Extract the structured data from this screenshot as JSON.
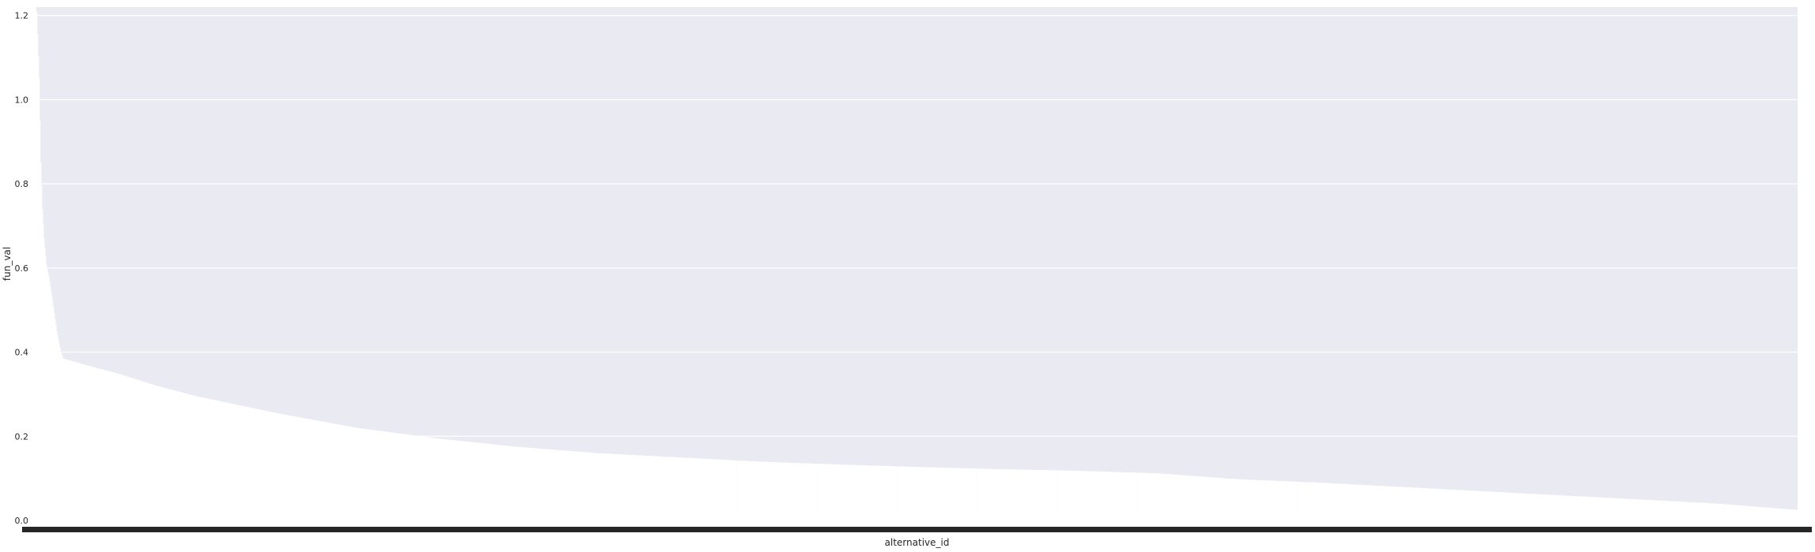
{
  "chart_data": {
    "type": "bar",
    "title": "",
    "xlabel": "alternative_id",
    "ylabel": "fun_val",
    "ylim": [
      0,
      1.22
    ],
    "yticks": [
      "0.0",
      "0.2",
      "0.4",
      "0.6",
      "0.8",
      "1.0",
      "1.2"
    ],
    "grid": true,
    "bar_color": "#ffffff",
    "background_color": "#eaeaf2",
    "x_tick_color": "#262626",
    "bar_count": 2200,
    "sorted": "descending",
    "value_profile": [
      [
        0,
        1.21
      ],
      [
        3,
        1.05
      ],
      [
        5,
        0.85
      ],
      [
        7,
        0.74
      ],
      [
        9,
        0.67
      ],
      [
        12,
        0.61
      ],
      [
        15,
        0.58
      ],
      [
        20,
        0.52
      ],
      [
        25,
        0.45
      ],
      [
        30,
        0.4
      ],
      [
        33,
        0.385
      ],
      [
        60,
        0.37
      ],
      [
        100,
        0.35
      ],
      [
        150,
        0.32
      ],
      [
        200,
        0.295
      ],
      [
        300,
        0.255
      ],
      [
        400,
        0.22
      ],
      [
        500,
        0.195
      ],
      [
        600,
        0.175
      ],
      [
        700,
        0.16
      ],
      [
        800,
        0.15
      ],
      [
        900,
        0.14
      ],
      [
        1000,
        0.133
      ],
      [
        1100,
        0.127
      ],
      [
        1200,
        0.122
      ],
      [
        1300,
        0.118
      ],
      [
        1400,
        0.112
      ],
      [
        1500,
        0.098
      ],
      [
        1600,
        0.09
      ],
      [
        1700,
        0.08
      ],
      [
        1800,
        0.07
      ],
      [
        1900,
        0.06
      ],
      [
        2000,
        0.05
      ],
      [
        2100,
        0.04
      ],
      [
        2199,
        0.025
      ]
    ]
  }
}
